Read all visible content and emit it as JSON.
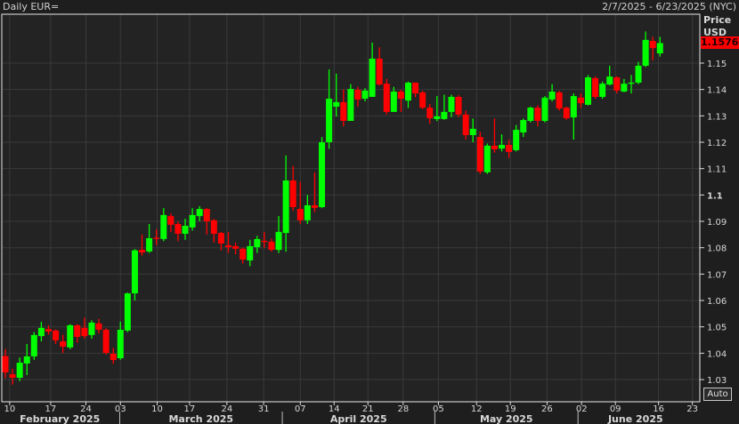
{
  "header": {
    "title": "Daily EUR=",
    "range": "2/7/2025 - 6/23/2025 (NYC)"
  },
  "axis": {
    "price_label": "Price",
    "currency_label": "USD",
    "auto_button": "Auto"
  },
  "colors": {
    "up": "#00ff00",
    "down": "#ff0000",
    "background": "#222222",
    "grid": "#3a3a3a"
  },
  "chart_data": {
    "type": "candlestick",
    "title": "Daily EUR=",
    "ylabel": "Price USD",
    "ylim": [
      1.025,
      1.165
    ],
    "yticks": [
      "1.03",
      "1.04",
      "1.05",
      "1.06",
      "1.07",
      "1.08",
      "1.09",
      "1.1",
      "1.11",
      "1.12",
      "1.13",
      "1.14",
      "1.15"
    ],
    "last_price": "1.1576",
    "xticks": [
      {
        "label": "10",
        "idx": 0.6
      },
      {
        "label": "17",
        "idx": 6.3
      },
      {
        "label": "24",
        "idx": 11.2
      },
      {
        "label": "03",
        "idx": 16
      },
      {
        "label": "10",
        "idx": 21.1
      },
      {
        "label": "17",
        "idx": 25.6
      },
      {
        "label": "24",
        "idx": 30.8
      },
      {
        "label": "31",
        "idx": 35.9
      },
      {
        "label": "07",
        "idx": 41
      },
      {
        "label": "14",
        "idx": 45.7
      },
      {
        "label": "21",
        "idx": 50.4
      },
      {
        "label": "28",
        "idx": 55.3
      },
      {
        "label": "05",
        "idx": 60.2
      },
      {
        "label": "12",
        "idx": 65.5
      },
      {
        "label": "19",
        "idx": 70.2
      },
      {
        "label": "26",
        "idx": 75.3
      },
      {
        "label": "02",
        "idx": 80.1
      },
      {
        "label": "09",
        "idx": 84.8
      },
      {
        "label": "16",
        "idx": 90.8
      },
      {
        "label": "23",
        "idx": 95.5
      }
    ],
    "months": [
      {
        "label": "February 2025",
        "start": -0.8,
        "end": 15.9
      },
      {
        "label": "March 2025",
        "start": 15.9,
        "end": 38.5
      },
      {
        "label": "April 2025",
        "start": 38.5,
        "end": 59.7
      },
      {
        "label": "May 2025",
        "start": 59.7,
        "end": 79.6
      },
      {
        "label": "June 2025",
        "start": 79.6,
        "end": 95.6
      }
    ],
    "ohlc": [
      [
        1.0389,
        1.0416,
        1.0305,
        1.0327
      ],
      [
        1.032,
        1.0341,
        1.0281,
        1.0307
      ],
      [
        1.0307,
        1.0384,
        1.0294,
        1.0364
      ],
      [
        1.0361,
        1.0435,
        1.0317,
        1.0388
      ],
      [
        1.0388,
        1.048,
        1.0375,
        1.0469
      ],
      [
        1.0465,
        1.0519,
        1.0445,
        1.0496
      ],
      [
        1.0492,
        1.0506,
        1.047,
        1.0482
      ],
      [
        1.0486,
        1.049,
        1.0435,
        1.0449
      ],
      [
        1.0445,
        1.047,
        1.0401,
        1.0425
      ],
      [
        1.0422,
        1.051,
        1.0415,
        1.0506
      ],
      [
        1.0506,
        1.051,
        1.044,
        1.0462
      ],
      [
        1.0496,
        1.0535,
        1.0455,
        1.0465
      ],
      [
        1.0469,
        1.0525,
        1.0455,
        1.0516
      ],
      [
        1.0513,
        1.053,
        1.0475,
        1.0489
      ],
      [
        1.0489,
        1.0495,
        1.0395,
        1.0401
      ],
      [
        1.0398,
        1.042,
        1.036,
        1.0374
      ],
      [
        1.0381,
        1.052,
        1.0375,
        1.0489
      ],
      [
        1.0486,
        1.063,
        1.048,
        1.0627
      ],
      [
        1.0627,
        1.0795,
        1.06,
        1.079
      ],
      [
        1.0792,
        1.085,
        1.077,
        1.0782
      ],
      [
        1.0786,
        1.089,
        1.078,
        1.0836
      ],
      [
        1.0838,
        1.087,
        1.081,
        1.0834
      ],
      [
        1.0833,
        1.095,
        1.0825,
        1.0924
      ],
      [
        1.092,
        1.093,
        1.086,
        1.0887
      ],
      [
        1.089,
        1.09,
        1.0825,
        1.0853
      ],
      [
        1.0853,
        1.091,
        1.083,
        1.0883
      ],
      [
        1.0877,
        1.095,
        1.0865,
        1.0924
      ],
      [
        1.092,
        1.0958,
        1.09,
        1.0947
      ],
      [
        1.0947,
        1.095,
        1.085,
        1.09
      ],
      [
        1.0904,
        1.091,
        1.082,
        1.0853
      ],
      [
        1.0856,
        1.086,
        1.079,
        1.0816
      ],
      [
        1.0809,
        1.086,
        1.078,
        1.0802
      ],
      [
        1.0806,
        1.082,
        1.0775,
        1.0796
      ],
      [
        1.0796,
        1.08,
        1.074,
        1.0755
      ],
      [
        1.0752,
        1.083,
        1.073,
        1.0806
      ],
      [
        1.0802,
        1.0845,
        1.078,
        1.0833
      ],
      [
        1.0826,
        1.086,
        1.08,
        1.0823
      ],
      [
        1.0823,
        1.0835,
        1.0785,
        1.0792
      ],
      [
        1.0792,
        1.092,
        1.078,
        1.086
      ],
      [
        1.0856,
        1.115,
        1.0785,
        1.1055
      ],
      [
        1.1055,
        1.111,
        1.094,
        1.0954
      ],
      [
        1.0947,
        1.105,
        1.089,
        1.0904
      ],
      [
        1.0904,
        1.1,
        1.089,
        1.0961
      ],
      [
        1.0961,
        1.1085,
        1.0935,
        1.0951
      ],
      [
        1.0954,
        1.122,
        1.095,
        1.12
      ],
      [
        1.12,
        1.1476,
        1.1175,
        1.1365
      ],
      [
        1.1335,
        1.146,
        1.1297,
        1.1352
      ],
      [
        1.1352,
        1.14,
        1.126,
        1.1281
      ],
      [
        1.1281,
        1.142,
        1.1281,
        1.1402
      ],
      [
        1.1399,
        1.141,
        1.1335,
        1.1362
      ],
      [
        1.1365,
        1.1405,
        1.1355,
        1.1396
      ],
      [
        1.1372,
        1.1578,
        1.1372,
        1.1517
      ],
      [
        1.1517,
        1.156,
        1.1415,
        1.1419
      ],
      [
        1.1422,
        1.144,
        1.1305,
        1.1315
      ],
      [
        1.1315,
        1.141,
        1.1315,
        1.1392
      ],
      [
        1.1392,
        1.14,
        1.1315,
        1.1365
      ],
      [
        1.1358,
        1.143,
        1.133,
        1.1426
      ],
      [
        1.1426,
        1.1426,
        1.137,
        1.1385
      ],
      [
        1.1389,
        1.1395,
        1.1325,
        1.1331
      ],
      [
        1.1331,
        1.1345,
        1.127,
        1.1291
      ],
      [
        1.1288,
        1.1375,
        1.128,
        1.1298
      ],
      [
        1.1288,
        1.138,
        1.1285,
        1.1315
      ],
      [
        1.1315,
        1.138,
        1.1295,
        1.1372
      ],
      [
        1.1372,
        1.1378,
        1.1295,
        1.1305
      ],
      [
        1.1305,
        1.132,
        1.121,
        1.1227
      ],
      [
        1.1227,
        1.129,
        1.12,
        1.1251
      ],
      [
        1.122,
        1.124,
        1.108,
        1.1089
      ],
      [
        1.1086,
        1.1195,
        1.108,
        1.1187
      ],
      [
        1.1187,
        1.129,
        1.116,
        1.1173
      ],
      [
        1.1176,
        1.123,
        1.1165,
        1.119
      ],
      [
        1.119,
        1.121,
        1.114,
        1.1163
      ],
      [
        1.117,
        1.1265,
        1.1165,
        1.1247
      ],
      [
        1.1237,
        1.129,
        1.122,
        1.1284
      ],
      [
        1.1281,
        1.1335,
        1.1275,
        1.1331
      ],
      [
        1.1331,
        1.134,
        1.126,
        1.1281
      ],
      [
        1.1281,
        1.1375,
        1.1275,
        1.1369
      ],
      [
        1.1362,
        1.142,
        1.1355,
        1.1392
      ],
      [
        1.1389,
        1.1395,
        1.132,
        1.1328
      ],
      [
        1.1331,
        1.1335,
        1.1285,
        1.1291
      ],
      [
        1.1294,
        1.1385,
        1.121,
        1.1375
      ],
      [
        1.1369,
        1.1385,
        1.133,
        1.1348
      ],
      [
        1.1342,
        1.1455,
        1.134,
        1.1446
      ],
      [
        1.1443,
        1.145,
        1.1365,
        1.1372
      ],
      [
        1.1372,
        1.143,
        1.1365,
        1.1422
      ],
      [
        1.1419,
        1.149,
        1.1415,
        1.1449
      ],
      [
        1.1446,
        1.145,
        1.1385,
        1.1396
      ],
      [
        1.1392,
        1.144,
        1.139,
        1.1422
      ],
      [
        1.1425,
        1.1455,
        1.1385,
        1.1426
      ],
      [
        1.1426,
        1.1505,
        1.142,
        1.149
      ],
      [
        1.149,
        1.162,
        1.1485,
        1.1588
      ],
      [
        1.1584,
        1.16,
        1.151,
        1.1557
      ],
      [
        1.1537,
        1.16,
        1.1525,
        1.1576
      ]
    ]
  }
}
